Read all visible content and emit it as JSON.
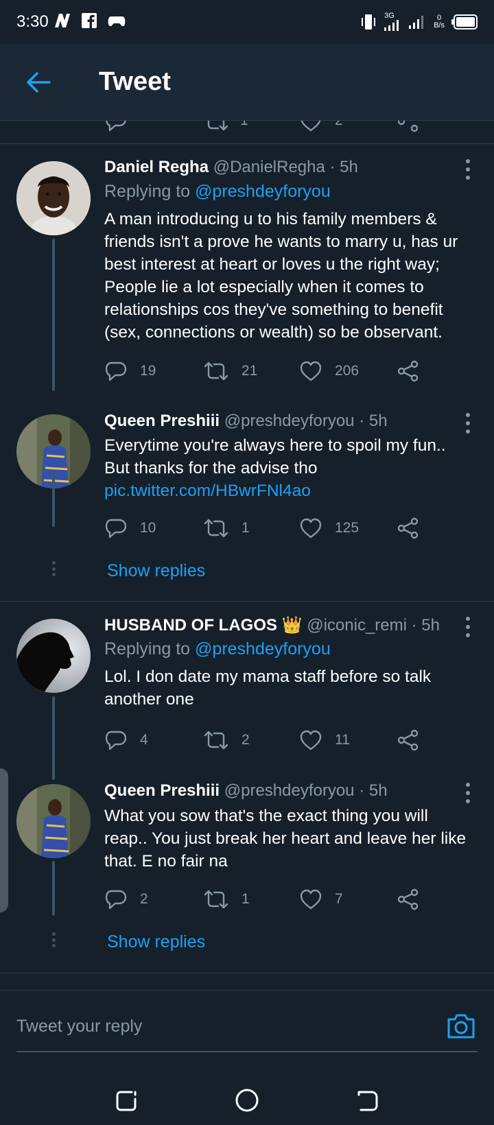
{
  "status_bar": {
    "time": "3:30",
    "network": "3G",
    "data_rate_value": "0",
    "data_rate_unit": "B/s"
  },
  "header": {
    "title": "Tweet"
  },
  "prev_actions": {
    "retweets": "1",
    "likes": "2"
  },
  "tweets": [
    {
      "name": "Daniel Regha",
      "handle": "@DanielRegha · 5h",
      "replying_prefix": "Replying to",
      "replying_to": "@preshdeyforyou",
      "text": "A man introducing u to his family members & friends isn't a prove he wants to marry u, has ur best interest at heart or loves u the right way; People lie a lot especially when it comes to relationships cos they've something to benefit (sex, connections or wealth) so be observant.",
      "replies": "19",
      "retweets": "21",
      "likes": "206"
    },
    {
      "name": "Queen Preshiii",
      "handle": "@preshdeyforyou · 5h",
      "text": "Everytime you're always here to spoil my fun.. But thanks for the advise tho",
      "link": "pic.twitter.com/HBwrFNl4ao",
      "replies": "10",
      "retweets": "1",
      "likes": "125",
      "show_replies": "Show replies"
    },
    {
      "name": "HUSBAND OF LAGOS 👑",
      "handle": "@iconic_remi · 5h",
      "replying_prefix": "Replying to",
      "replying_to": "@preshdeyforyou",
      "text": "Lol. I don date my mama staff before so talk another one",
      "replies": "4",
      "retweets": "2",
      "likes": "11"
    },
    {
      "name": "Queen Preshiii",
      "handle": "@preshdeyforyou · 5h",
      "text": "What you sow that's the exact thing you will reap.. You just break her heart and leave her like that. E no fair na",
      "replies": "2",
      "retweets": "1",
      "likes": "7",
      "show_replies": "Show replies"
    }
  ],
  "reply_bar": {
    "placeholder": "Tweet your reply"
  },
  "colors": {
    "background": "#15202b",
    "header": "#1b2836",
    "accent": "#1da1f2",
    "muted": "#8899a6"
  }
}
